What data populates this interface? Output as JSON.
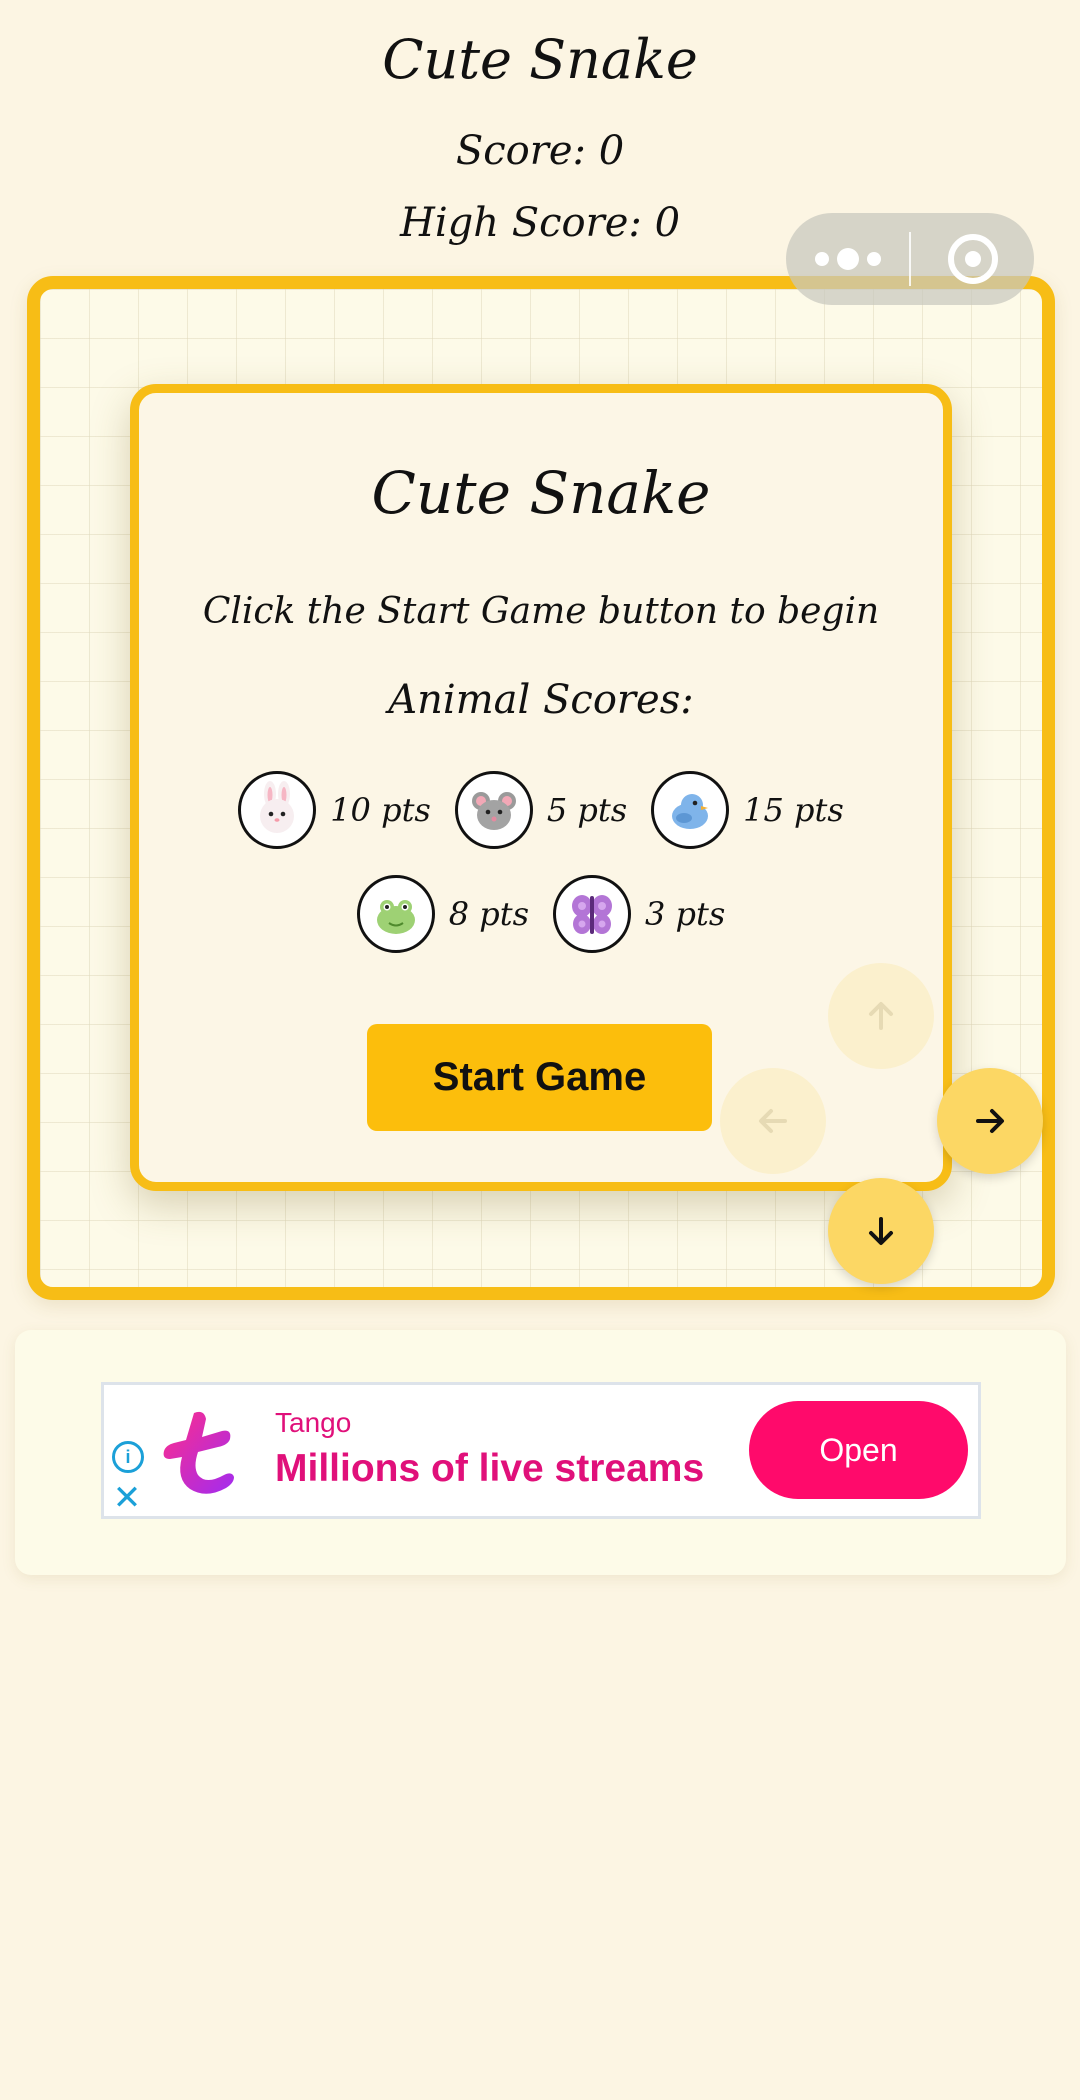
{
  "header": {
    "title": "Cute Snake",
    "score_text": "Score: 0",
    "high_score_text": "High Score: 0"
  },
  "capsule": {
    "more_icon": "more-dots-icon",
    "close_icon": "target-circle-icon"
  },
  "menu": {
    "title": "Cute Snake",
    "instructions": "Click the Start Game button to begin",
    "scores_heading": "Animal Scores:",
    "animals": [
      {
        "icon": "rabbit-icon",
        "points": "10 pts"
      },
      {
        "icon": "mouse-icon",
        "points": "5 pts"
      },
      {
        "icon": "bird-icon",
        "points": "15 pts"
      },
      {
        "icon": "frog-icon",
        "points": "8 pts"
      },
      {
        "icon": "butterfly-icon",
        "points": "3 pts"
      }
    ],
    "start_button": "Start Game"
  },
  "controls": {
    "up_icon": "arrow-up-icon",
    "left_icon": "arrow-left-icon",
    "right_icon": "arrow-right-icon",
    "down_icon": "arrow-down-icon"
  },
  "ad": {
    "brand": "Tango",
    "headline": "Millions of live streams",
    "open_button": "Open",
    "info_icon": "info-icon",
    "close_icon": "close-icon"
  },
  "colors": {
    "background": "#fcf5e3",
    "accent_yellow": "#f7bd16",
    "start_button": "#fcbe0c",
    "ad_pink": "#ff0a6b"
  }
}
